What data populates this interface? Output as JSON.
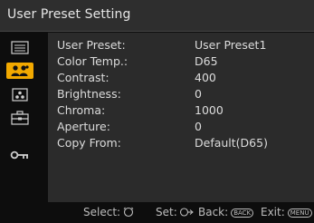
{
  "window": {
    "title": "User Preset Setting"
  },
  "sidebar": {
    "tabs": [
      {
        "icon": "menu-list-icon",
        "active": false
      },
      {
        "icon": "user-preset-icon",
        "active": true
      },
      {
        "icon": "camera-setting-icon",
        "active": false
      },
      {
        "icon": "case-icon",
        "active": false
      },
      {
        "icon": "key-icon",
        "active": false
      }
    ]
  },
  "settings": [
    {
      "label": "User Preset:",
      "value": "User Preset1"
    },
    {
      "label": "Color Temp.:",
      "value": "D65"
    },
    {
      "label": "Contrast:",
      "value": "400"
    },
    {
      "label": "Brightness:",
      "value": "0"
    },
    {
      "label": "Chroma:",
      "value": "1000"
    },
    {
      "label": "Aperture:",
      "value": "0"
    },
    {
      "label": "Copy From:",
      "value": "Default(D65)"
    }
  ],
  "footer": {
    "select_label": "Select:",
    "set_label": "Set:",
    "back_label": "Back:",
    "back_key": "BACK",
    "exit_label": "Exit:",
    "exit_key": "MENU"
  },
  "colors": {
    "accent": "#f2a900",
    "panel": "#2b2b2b",
    "title_bar": "#2e2e2e",
    "background": "#0d0d0d"
  }
}
